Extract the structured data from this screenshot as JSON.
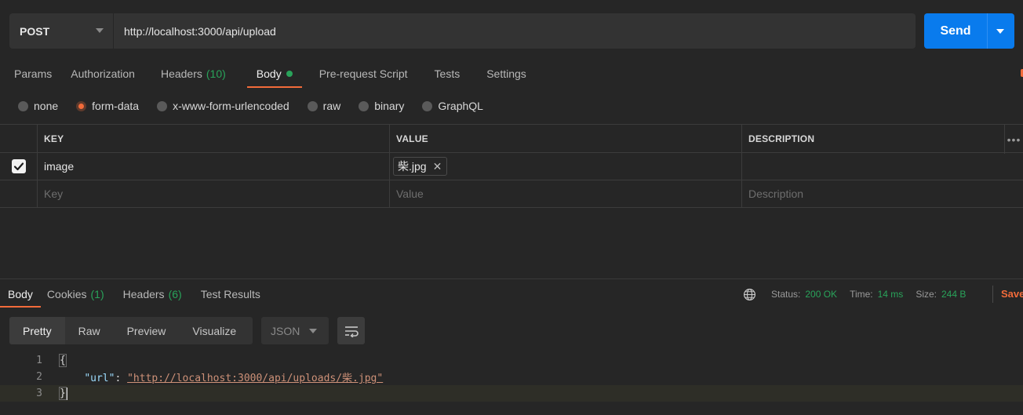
{
  "request": {
    "method": "POST",
    "url": "http://localhost:3000/api/upload",
    "send_label": "Send"
  },
  "req_tabs": {
    "params": "Params",
    "authorization": "Authorization",
    "headers": "Headers",
    "headers_count": "(10)",
    "body": "Body",
    "pre_request": "Pre-request Script",
    "tests": "Tests",
    "settings": "Settings"
  },
  "body_types": {
    "none": "none",
    "form_data": "form-data",
    "urlencoded": "x-www-form-urlencoded",
    "raw": "raw",
    "binary": "binary",
    "graphql": "GraphQL",
    "selected": "form-data"
  },
  "table": {
    "headers": {
      "key": "KEY",
      "value": "VALUE",
      "description": "DESCRIPTION"
    },
    "rows": [
      {
        "checked": true,
        "key": "image",
        "value": "柴.jpg",
        "description": ""
      }
    ],
    "placeholders": {
      "key": "Key",
      "value": "Value",
      "description": "Description"
    },
    "more": "•••"
  },
  "res_tabs": {
    "body": "Body",
    "cookies": "Cookies",
    "cookies_count": "(1)",
    "headers": "Headers",
    "headers_count": "(6)",
    "test_results": "Test Results"
  },
  "status": {
    "status_label": "Status:",
    "status_value": "200 OK",
    "time_label": "Time:",
    "time_value": "14 ms",
    "size_label": "Size:",
    "size_value": "244 B",
    "save_label": "Save"
  },
  "format": {
    "pretty": "Pretty",
    "raw": "Raw",
    "preview": "Preview",
    "visualize": "Visualize",
    "language": "JSON"
  },
  "code": {
    "line_numbers": [
      "1",
      "2",
      "3"
    ],
    "open_brace": "{",
    "key": "\"url\"",
    "colon": ": ",
    "value": "\"http://localhost:3000/api/uploads/柴.jpg\"",
    "close_brace": "}"
  },
  "colors": {
    "accent": "#f26b3a",
    "send": "#097bed",
    "success": "#29a35a",
    "background": "#262626"
  }
}
